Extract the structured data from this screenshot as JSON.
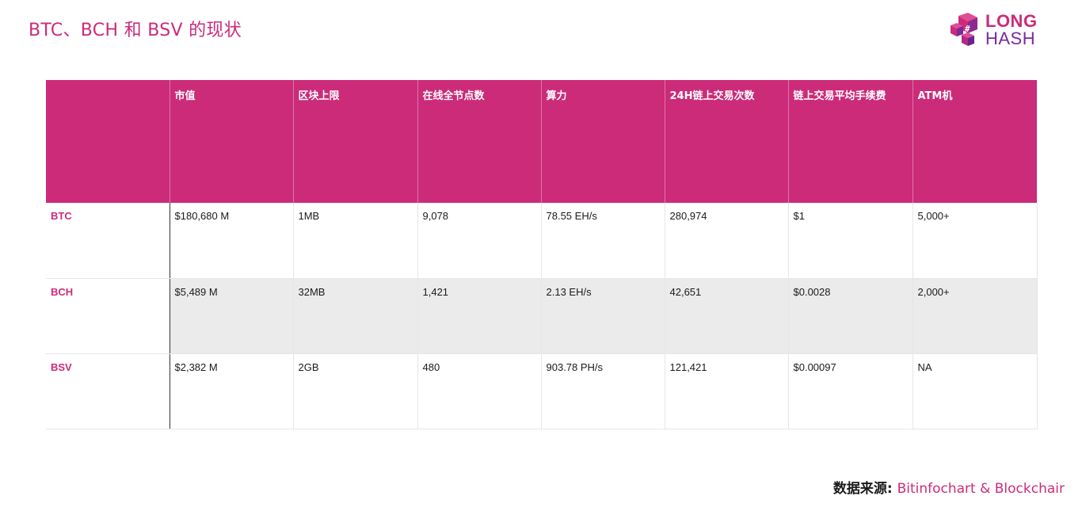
{
  "title": "BTC、BCH 和 BSV 的现状",
  "logo": {
    "line1": "LONG",
    "line2": "HASH"
  },
  "colors": {
    "accent": "#cc2b7a",
    "row_shade": "#ebebeb"
  },
  "table": {
    "columns": [
      "",
      "市值",
      "区块上限",
      "在线全节点数",
      "算力",
      "24H链上交易次数",
      "链上交易平均手续费",
      "ATM机"
    ],
    "rows": [
      [
        "BTC",
        "$180,680 M",
        "1MB",
        "9,078",
        "78.55 EH/s",
        "280,974",
        "$1",
        "5,000+"
      ],
      [
        "BCH",
        "$5,489 M",
        "32MB",
        "1,421",
        "2.13 EH/s",
        "42,651",
        "$0.0028",
        "2,000+"
      ],
      [
        "BSV",
        "$2,382 M",
        "2GB",
        "480",
        "903.78 PH/s",
        "121,421",
        "$0.00097",
        "NA"
      ]
    ]
  },
  "source": {
    "label": "数据来源: ",
    "value": "Bitinfochart & Blockchair"
  }
}
